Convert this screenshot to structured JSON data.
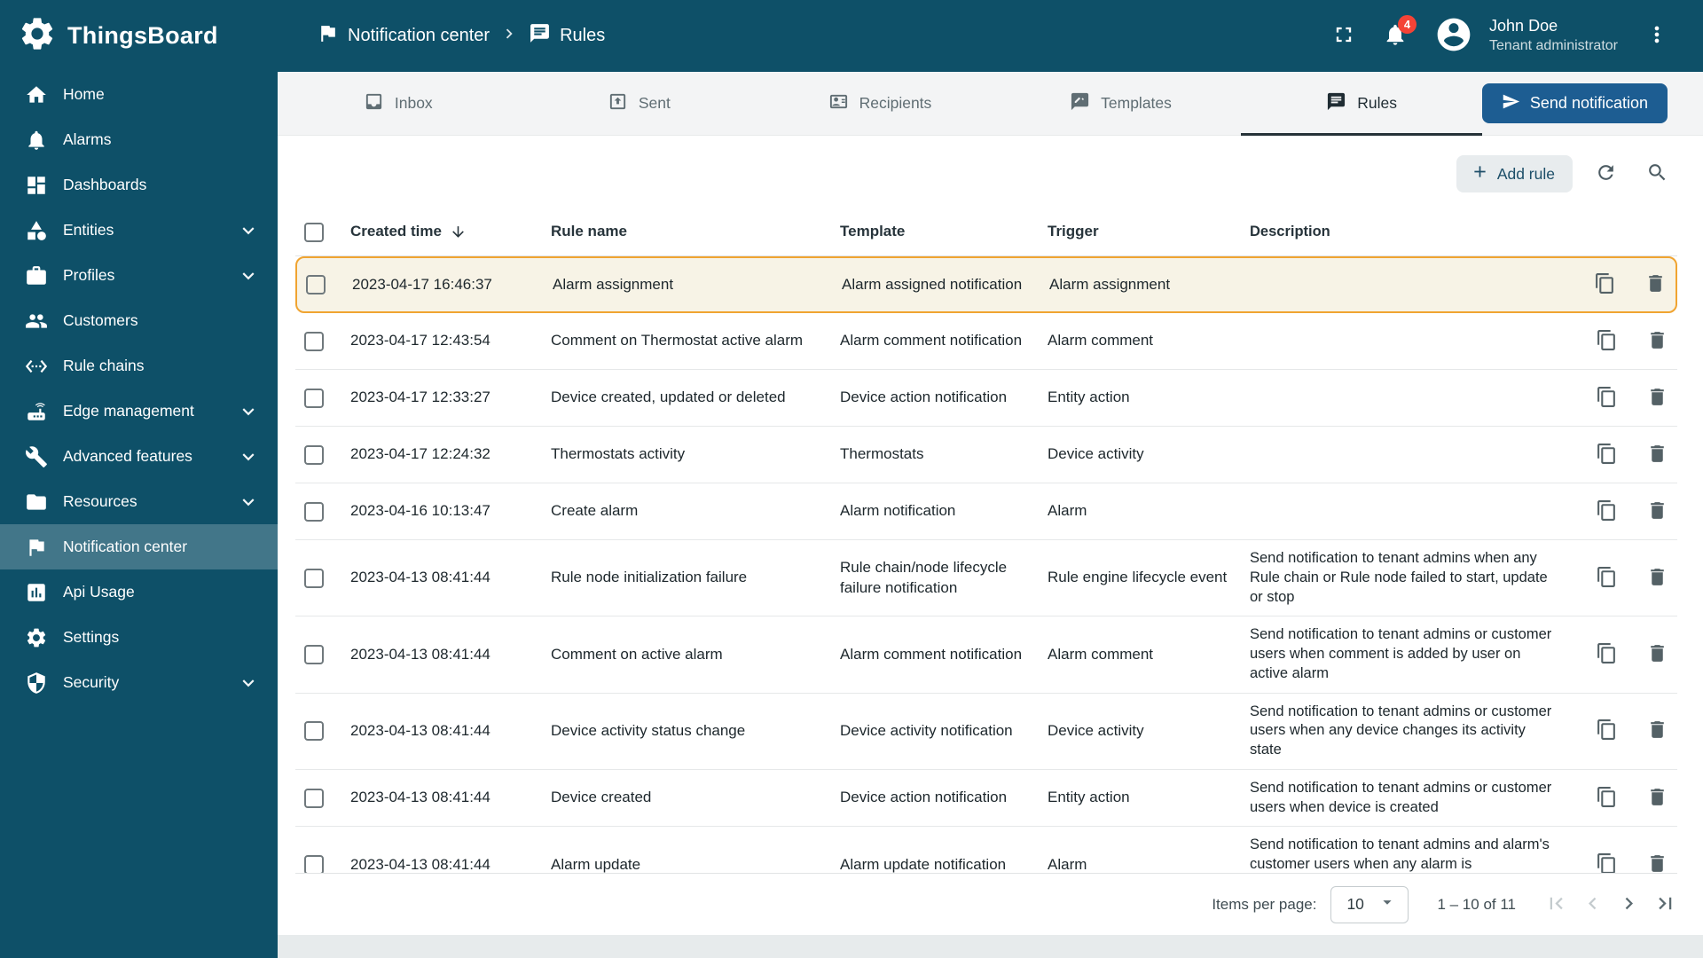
{
  "app": {
    "name": "ThingsBoard"
  },
  "colors": {
    "sidebar_bg": "#0e5068",
    "primary_button": "#1d5d92",
    "highlight_border": "#f0a431",
    "highlight_bg": "#f7f3e6",
    "notification_badge": "#f44336"
  },
  "sidebar": {
    "items": [
      {
        "label": "Home",
        "icon": "home-icon"
      },
      {
        "label": "Alarms",
        "icon": "alarms-icon"
      },
      {
        "label": "Dashboards",
        "icon": "dashboards-icon"
      },
      {
        "label": "Entities",
        "icon": "entities-icon",
        "expandable": true
      },
      {
        "label": "Profiles",
        "icon": "profiles-icon",
        "expandable": true
      },
      {
        "label": "Customers",
        "icon": "customers-icon"
      },
      {
        "label": "Rule chains",
        "icon": "rule-chains-icon"
      },
      {
        "label": "Edge management",
        "icon": "edge-management-icon",
        "expandable": true
      },
      {
        "label": "Advanced features",
        "icon": "advanced-features-icon",
        "expandable": true
      },
      {
        "label": "Resources",
        "icon": "resources-icon",
        "expandable": true
      },
      {
        "label": "Notification center",
        "icon": "notification-center-icon",
        "active": true
      },
      {
        "label": "Api Usage",
        "icon": "api-usage-icon"
      },
      {
        "label": "Settings",
        "icon": "settings-icon"
      },
      {
        "label": "Security",
        "icon": "security-icon",
        "expandable": true
      }
    ]
  },
  "header": {
    "breadcrumb": {
      "parent": "Notification center",
      "current": "Rules"
    },
    "notification_count": "4",
    "user": {
      "name": "John Doe",
      "role": "Tenant administrator"
    }
  },
  "tabs": {
    "items": [
      {
        "label": "Inbox",
        "icon": "inbox-icon"
      },
      {
        "label": "Sent",
        "icon": "sent-icon"
      },
      {
        "label": "Recipients",
        "icon": "recipients-icon"
      },
      {
        "label": "Templates",
        "icon": "templates-icon"
      },
      {
        "label": "Rules",
        "icon": "rules-icon",
        "active": true
      }
    ],
    "send_button": "Send notification"
  },
  "toolbar": {
    "add_rule": "Add rule"
  },
  "table": {
    "columns": {
      "created": "Created time",
      "name": "Rule name",
      "template": "Template",
      "trigger": "Trigger",
      "description": "Description"
    },
    "sort": {
      "column": "Created time",
      "direction": "desc"
    },
    "rows": [
      {
        "highlighted": true,
        "created": "2023-04-17 16:46:37",
        "name": "Alarm assignment",
        "template": "Alarm assigned notification",
        "trigger": "Alarm assignment",
        "description": ""
      },
      {
        "created": "2023-04-17 12:43:54",
        "name": "Comment on Thermostat active alarm",
        "template": "Alarm comment notification",
        "trigger": "Alarm comment",
        "description": ""
      },
      {
        "created": "2023-04-17 12:33:27",
        "name": "Device created, updated or deleted",
        "template": "Device action notification",
        "trigger": "Entity action",
        "description": ""
      },
      {
        "created": "2023-04-17 12:24:32",
        "name": "Thermostats activity",
        "template": "Thermostats",
        "trigger": "Device activity",
        "description": ""
      },
      {
        "created": "2023-04-16 10:13:47",
        "name": "Create alarm",
        "template": "Alarm notification",
        "trigger": "Alarm",
        "description": ""
      },
      {
        "created": "2023-04-13 08:41:44",
        "name": "Rule node initialization failure",
        "template": "Rule chain/node lifecycle failure notification",
        "trigger": "Rule engine lifecycle event",
        "description": "Send notification to tenant admins when any Rule chain or Rule node failed to start, update or stop"
      },
      {
        "created": "2023-04-13 08:41:44",
        "name": "Comment on active alarm",
        "template": "Alarm comment notification",
        "trigger": "Alarm comment",
        "description": "Send notification to tenant admins or customer users when comment is added by user on active alarm"
      },
      {
        "created": "2023-04-13 08:41:44",
        "name": "Device activity status change",
        "template": "Device activity notification",
        "trigger": "Device activity",
        "description": "Send notification to tenant admins or customer users when any device changes its activity state"
      },
      {
        "created": "2023-04-13 08:41:44",
        "name": "Device created",
        "template": "Device action notification",
        "trigger": "Entity action",
        "description": "Send notification to tenant admins or customer users when device is created"
      },
      {
        "created": "2023-04-13 08:41:44",
        "name": "Alarm update",
        "template": "Alarm update notification",
        "trigger": "Alarm",
        "description": "Send notification to tenant admins and alarm's customer users when any alarm is acknowledged or cleared"
      }
    ]
  },
  "pagination": {
    "items_per_page_label": "Items per page:",
    "items_per_page": "10",
    "range": "1 – 10 of 11"
  }
}
